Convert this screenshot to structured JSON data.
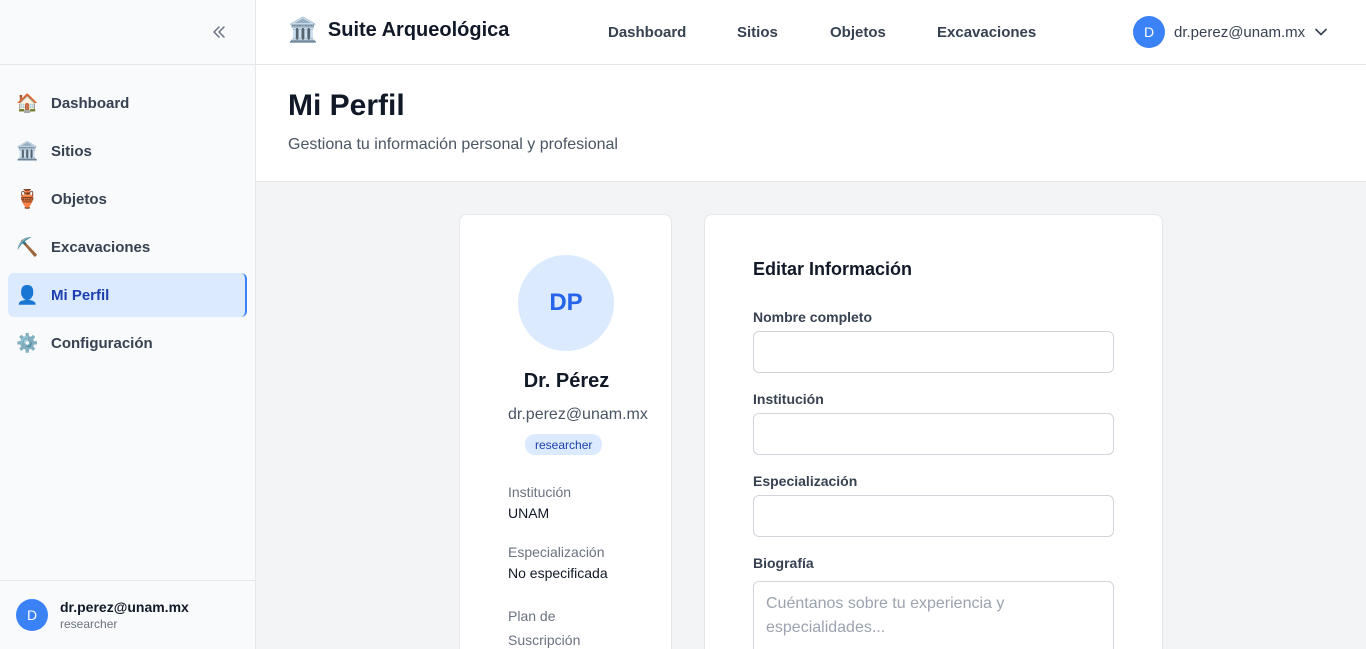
{
  "sidebar": {
    "collapse_icon": "chevrons-left-icon",
    "items": [
      {
        "icon": "🏠",
        "label": "Dashboard"
      },
      {
        "icon": "🏛️",
        "label": "Sitios"
      },
      {
        "icon": "🏺",
        "label": "Objetos"
      },
      {
        "icon": "⛏️",
        "label": "Excavaciones"
      },
      {
        "icon": "👤",
        "label": "Mi Perfil",
        "active": true
      },
      {
        "icon": "⚙️",
        "label": "Configuración"
      }
    ],
    "user": {
      "initial": "D",
      "email": "dr.perez@unam.mx",
      "role": "researcher"
    }
  },
  "header": {
    "logo": "🏛️",
    "app_title": "Suite Arqueológica",
    "nav": [
      "Dashboard",
      "Sitios",
      "Objetos",
      "Excavaciones"
    ],
    "user": {
      "initial": "D",
      "email": "dr.perez@unam.mx"
    }
  },
  "page": {
    "title": "Mi Perfil",
    "subtitle": "Gestiona tu información personal y profesional"
  },
  "profile": {
    "initials": "DP",
    "name": "Dr. Pérez",
    "email": "dr.perez@unam.mx",
    "role_badge": "researcher",
    "institution_label": "Institución",
    "institution_value": "UNAM",
    "specialization_label": "Especialización",
    "specialization_value": "No especificada",
    "plan_label": "Plan de Suscripción"
  },
  "form": {
    "title": "Editar Información",
    "full_name_label": "Nombre completo",
    "full_name_value": "",
    "institution_label": "Institución",
    "institution_value": "",
    "specialization_label": "Especialización",
    "specialization_value": "",
    "bio_label": "Biografía",
    "bio_placeholder": "Cuéntanos sobre tu experiencia y especialidades..."
  },
  "colors": {
    "accent": "#3b82f6",
    "active_bg": "#dbeafe",
    "active_text": "#1e40af"
  }
}
